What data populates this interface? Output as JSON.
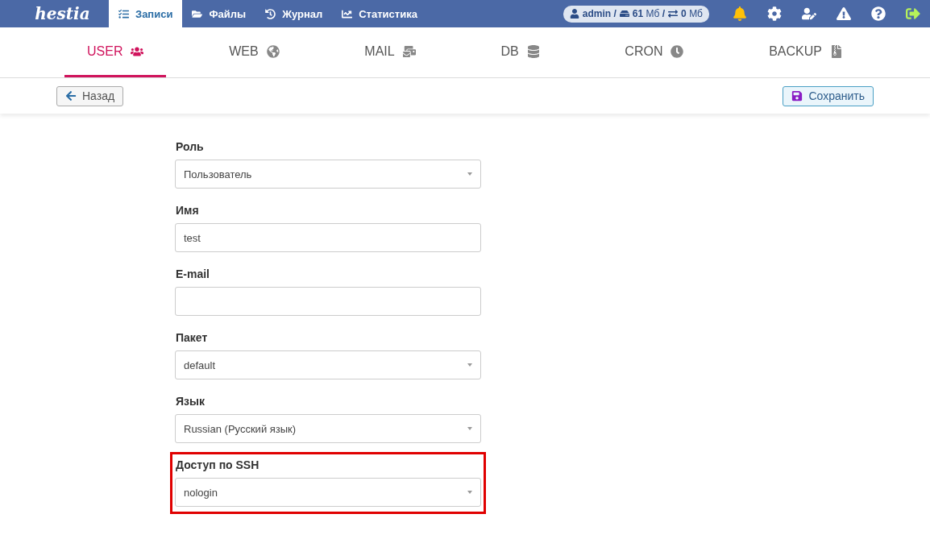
{
  "logo": "hestia",
  "top_nav": [
    {
      "label": "Записи",
      "selected": true
    },
    {
      "label": "Файлы",
      "selected": false
    },
    {
      "label": "Журнал",
      "selected": false
    },
    {
      "label": "Статистика",
      "selected": false
    }
  ],
  "usage": {
    "user": "admin",
    "separator_1": "/",
    "disk": "61",
    "disk_unit": "Мб",
    "separator_2": "/",
    "bandwidth": "0",
    "bandwidth_unit": "Мб"
  },
  "section_tabs": [
    {
      "label": "USER",
      "selected": true
    },
    {
      "label": "WEB",
      "selected": false
    },
    {
      "label": "MAIL",
      "selected": false
    },
    {
      "label": "DB",
      "selected": false
    },
    {
      "label": "CRON",
      "selected": false
    },
    {
      "label": "BACKUP",
      "selected": false
    }
  ],
  "toolbar": {
    "back": "Назад",
    "save": "Сохранить"
  },
  "fields": [
    {
      "label": "Роль",
      "kind": "select",
      "value": "Пользователь",
      "highlighted": false
    },
    {
      "label": "Имя",
      "kind": "input",
      "value": "test",
      "highlighted": false
    },
    {
      "label": "E-mail",
      "kind": "input",
      "highlighted": false
    },
    {
      "label": "Пакет",
      "kind": "select",
      "value": "default",
      "highlighted": false
    },
    {
      "label": "Язык",
      "kind": "select",
      "value": "Russian (Русский язык)",
      "highlighted": false
    },
    {
      "label": "Доступ по SSH",
      "kind": "select",
      "value": "nologin",
      "highlighted": true
    }
  ]
}
